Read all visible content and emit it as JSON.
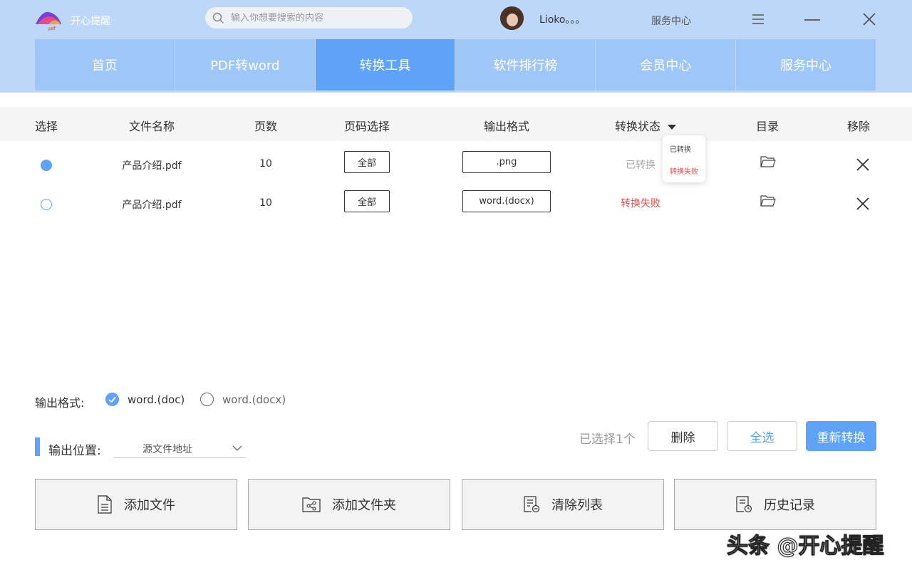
{
  "app": {
    "title": "开心提醒"
  },
  "search": {
    "placeholder": "输入你想要搜索的内容"
  },
  "user": {
    "name": "Lioko。。。"
  },
  "header_links": {
    "service": "服务中心"
  },
  "nav": [
    {
      "label": "首页",
      "active": false
    },
    {
      "label": "PDF转word",
      "active": false
    },
    {
      "label": "转换工具",
      "active": true
    },
    {
      "label": "软件排行榜",
      "active": false
    },
    {
      "label": "会员中心",
      "active": false
    },
    {
      "label": "服务中心",
      "active": false
    }
  ],
  "table": {
    "headers": {
      "select": "选择",
      "filename": "文件名称",
      "pages": "页数",
      "page_select": "页码选择",
      "output_format": "输出格式",
      "status": "转换状态",
      "directory": "目录",
      "remove": "移除"
    },
    "rows": [
      {
        "checked": true,
        "filename": "产品介绍.pdf",
        "pages": "10",
        "page_select": "全部",
        "format": ".png",
        "status": "已转换"
      },
      {
        "checked": false,
        "filename": "产品介绍.pdf",
        "pages": "10",
        "page_select": "全部",
        "format": "word.(docx)",
        "status": "转换失败"
      }
    ]
  },
  "status_dropdown": {
    "options": [
      "已转换",
      "转换失败"
    ]
  },
  "output_format": {
    "label": "输出格式:",
    "options": [
      {
        "label": "word.(doc)",
        "checked": true
      },
      {
        "label": "word.(docx)",
        "checked": false
      }
    ]
  },
  "output_location": {
    "label": "输出位置:",
    "value": "源文件地址"
  },
  "selection": {
    "count_text": "已选择1个"
  },
  "actions": {
    "delete": "删除",
    "select_all": "全选",
    "reconvert": "重新转换"
  },
  "bottom_buttons": {
    "add_file": "添加文件",
    "add_folder": "添加文件夹",
    "clear_list": "清除列表",
    "history": "历史记录"
  },
  "watermark": "头条 @开心提醒",
  "colors": {
    "header_bg": "#bcd7f8",
    "nav_bg": "#9ec7f8",
    "nav_active": "#5ea3f7",
    "accent": "#5ea3f7",
    "fail": "#e84e4e"
  }
}
